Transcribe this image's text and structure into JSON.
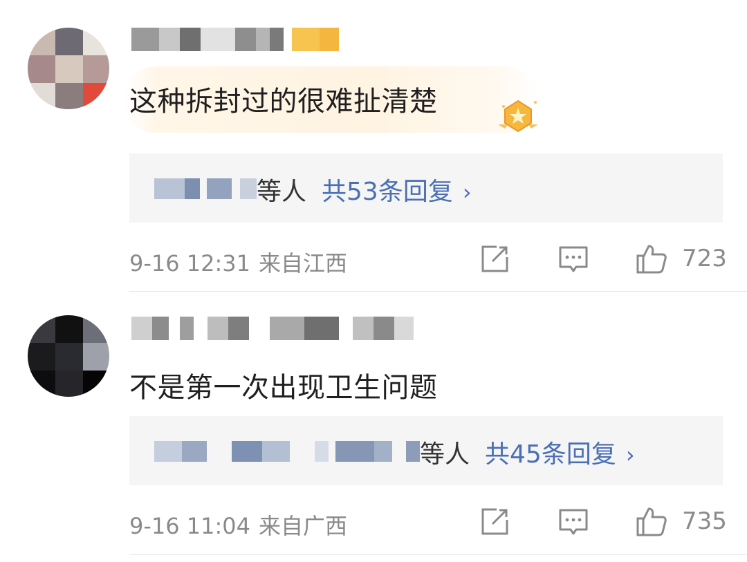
{
  "comments": [
    {
      "text": "这种拆封过的很难扯清楚",
      "reply_suffix": "等人",
      "reply_count": "共53条回复",
      "reply_chevron": "›",
      "time": "9-16 12:31",
      "location": "来自江西",
      "likes": "723"
    },
    {
      "text": "不是第一次出现卫生问题",
      "reply_suffix": "等人",
      "reply_count": "共45条回复",
      "reply_chevron": "›",
      "time": "9-16 11:04",
      "location": "来自广西",
      "likes": "735"
    }
  ],
  "icons": {
    "share": "share-icon",
    "comment": "comment-icon",
    "like": "like-icon",
    "badge": "medal-badge-icon"
  },
  "colors": {
    "reply_link": "#4a6fb5",
    "meta_gray": "#8a8a8a",
    "reply_bg": "#f5f5f5",
    "highlight_bg": "#fff4e2",
    "badge_gold": "#f6b73c"
  }
}
